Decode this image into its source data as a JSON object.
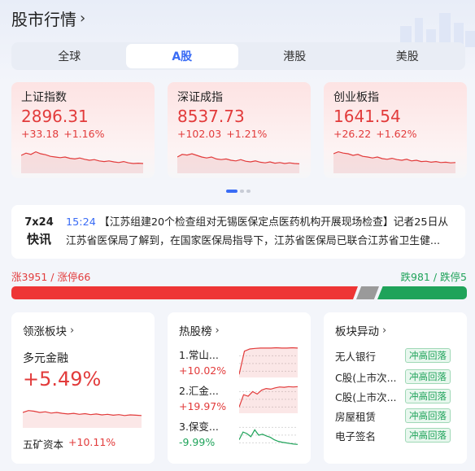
{
  "page": {
    "title": "股市行情"
  },
  "tabs": [
    {
      "label": "全球"
    },
    {
      "label": "A股"
    },
    {
      "label": "港股"
    },
    {
      "label": "美股"
    }
  ],
  "indices": [
    {
      "name": "上证指数",
      "value": "2896.31",
      "change": "+33.18",
      "pct": "+1.16%",
      "spark": [
        0.55,
        0.62,
        0.58,
        0.66,
        0.6,
        0.57,
        0.52,
        0.5,
        0.48,
        0.5,
        0.46,
        0.44,
        0.47,
        0.43,
        0.4,
        0.42,
        0.38,
        0.36,
        0.38,
        0.35,
        0.33,
        0.36,
        0.32,
        0.3,
        0.31,
        0.3
      ]
    },
    {
      "name": "深证成指",
      "value": "8537.73",
      "change": "+102.03",
      "pct": "+1.21%",
      "spark": [
        0.5,
        0.58,
        0.56,
        0.6,
        0.55,
        0.5,
        0.47,
        0.5,
        0.44,
        0.42,
        0.44,
        0.4,
        0.38,
        0.42,
        0.37,
        0.35,
        0.38,
        0.34,
        0.32,
        0.35,
        0.31,
        0.33,
        0.3,
        0.32,
        0.3,
        0.29
      ]
    },
    {
      "name": "创业板指",
      "value": "1641.54",
      "change": "+26.22",
      "pct": "+1.62%",
      "spark": [
        0.6,
        0.66,
        0.62,
        0.6,
        0.55,
        0.58,
        0.52,
        0.5,
        0.47,
        0.5,
        0.45,
        0.43,
        0.46,
        0.42,
        0.4,
        0.43,
        0.38,
        0.4,
        0.36,
        0.37,
        0.34,
        0.36,
        0.33,
        0.34,
        0.32,
        0.33
      ]
    }
  ],
  "news": {
    "badge_top": "7x24",
    "badge_bottom": "快讯",
    "time": "15:24",
    "text": "【江苏组建20个检查组对无锡医保定点医药机构开展现场检查】记者25日从江苏省医保局了解到，在国家医保局指导下，江苏省医保局已联合江苏省卫生健..."
  },
  "breadth": {
    "up_label": "涨3951 / 涨停66",
    "down_label": "跌981 / 跌停5",
    "up_count": 3951,
    "down_count": 981
  },
  "sector": {
    "title": "领涨板块",
    "name": "多元金融",
    "pct": "+5.49%",
    "lead_stock": "五矿资本",
    "lead_pct": "+10.11%",
    "spark": [
      0.5,
      0.56,
      0.54,
      0.5,
      0.52,
      0.48,
      0.5,
      0.47,
      0.45,
      0.47,
      0.44,
      0.46,
      0.43,
      0.45,
      0.42,
      0.44,
      0.41,
      0.43,
      0.4,
      0.42,
      0.41,
      0.4
    ]
  },
  "hot": {
    "title": "热股榜",
    "items": [
      {
        "name": "1.常山...",
        "pct": "+10.02%",
        "dir": "up",
        "spark": [
          0.1,
          0.85,
          0.92,
          0.94,
          0.95,
          0.95,
          0.95,
          0.96,
          0.95,
          0.95,
          0.96,
          0.95
        ]
      },
      {
        "name": "2.汇金...",
        "pct": "+19.97%",
        "dir": "up",
        "spark": [
          0.2,
          0.6,
          0.55,
          0.7,
          0.62,
          0.75,
          0.8,
          0.78,
          0.82,
          0.85,
          0.84,
          0.86,
          0.85,
          0.86
        ]
      },
      {
        "name": "3.保变...",
        "pct": "-9.99%",
        "dir": "down",
        "spark": [
          0.3,
          0.55,
          0.5,
          0.4,
          0.62,
          0.45,
          0.48,
          0.42,
          0.38,
          0.3,
          0.25,
          0.22,
          0.2,
          0.18,
          0.16,
          0.15
        ]
      }
    ]
  },
  "moves": {
    "title": "板块异动",
    "items": [
      {
        "name": "无人银行",
        "tag": "冲高回落"
      },
      {
        "name": "C股(上市次...",
        "tag": "冲高回落"
      },
      {
        "name": "C股(上市次...",
        "tag": "冲高回落"
      },
      {
        "name": "房屋租赁",
        "tag": "冲高回落"
      },
      {
        "name": "电子签名",
        "tag": "冲高回落"
      }
    ]
  },
  "colors": {
    "up": "#e23b3b",
    "down": "#1fa35a",
    "accent": "#3a6cf5",
    "flat": "#9a9a9a"
  },
  "icons": {
    "title_arrow": "chevron-right-icon"
  }
}
